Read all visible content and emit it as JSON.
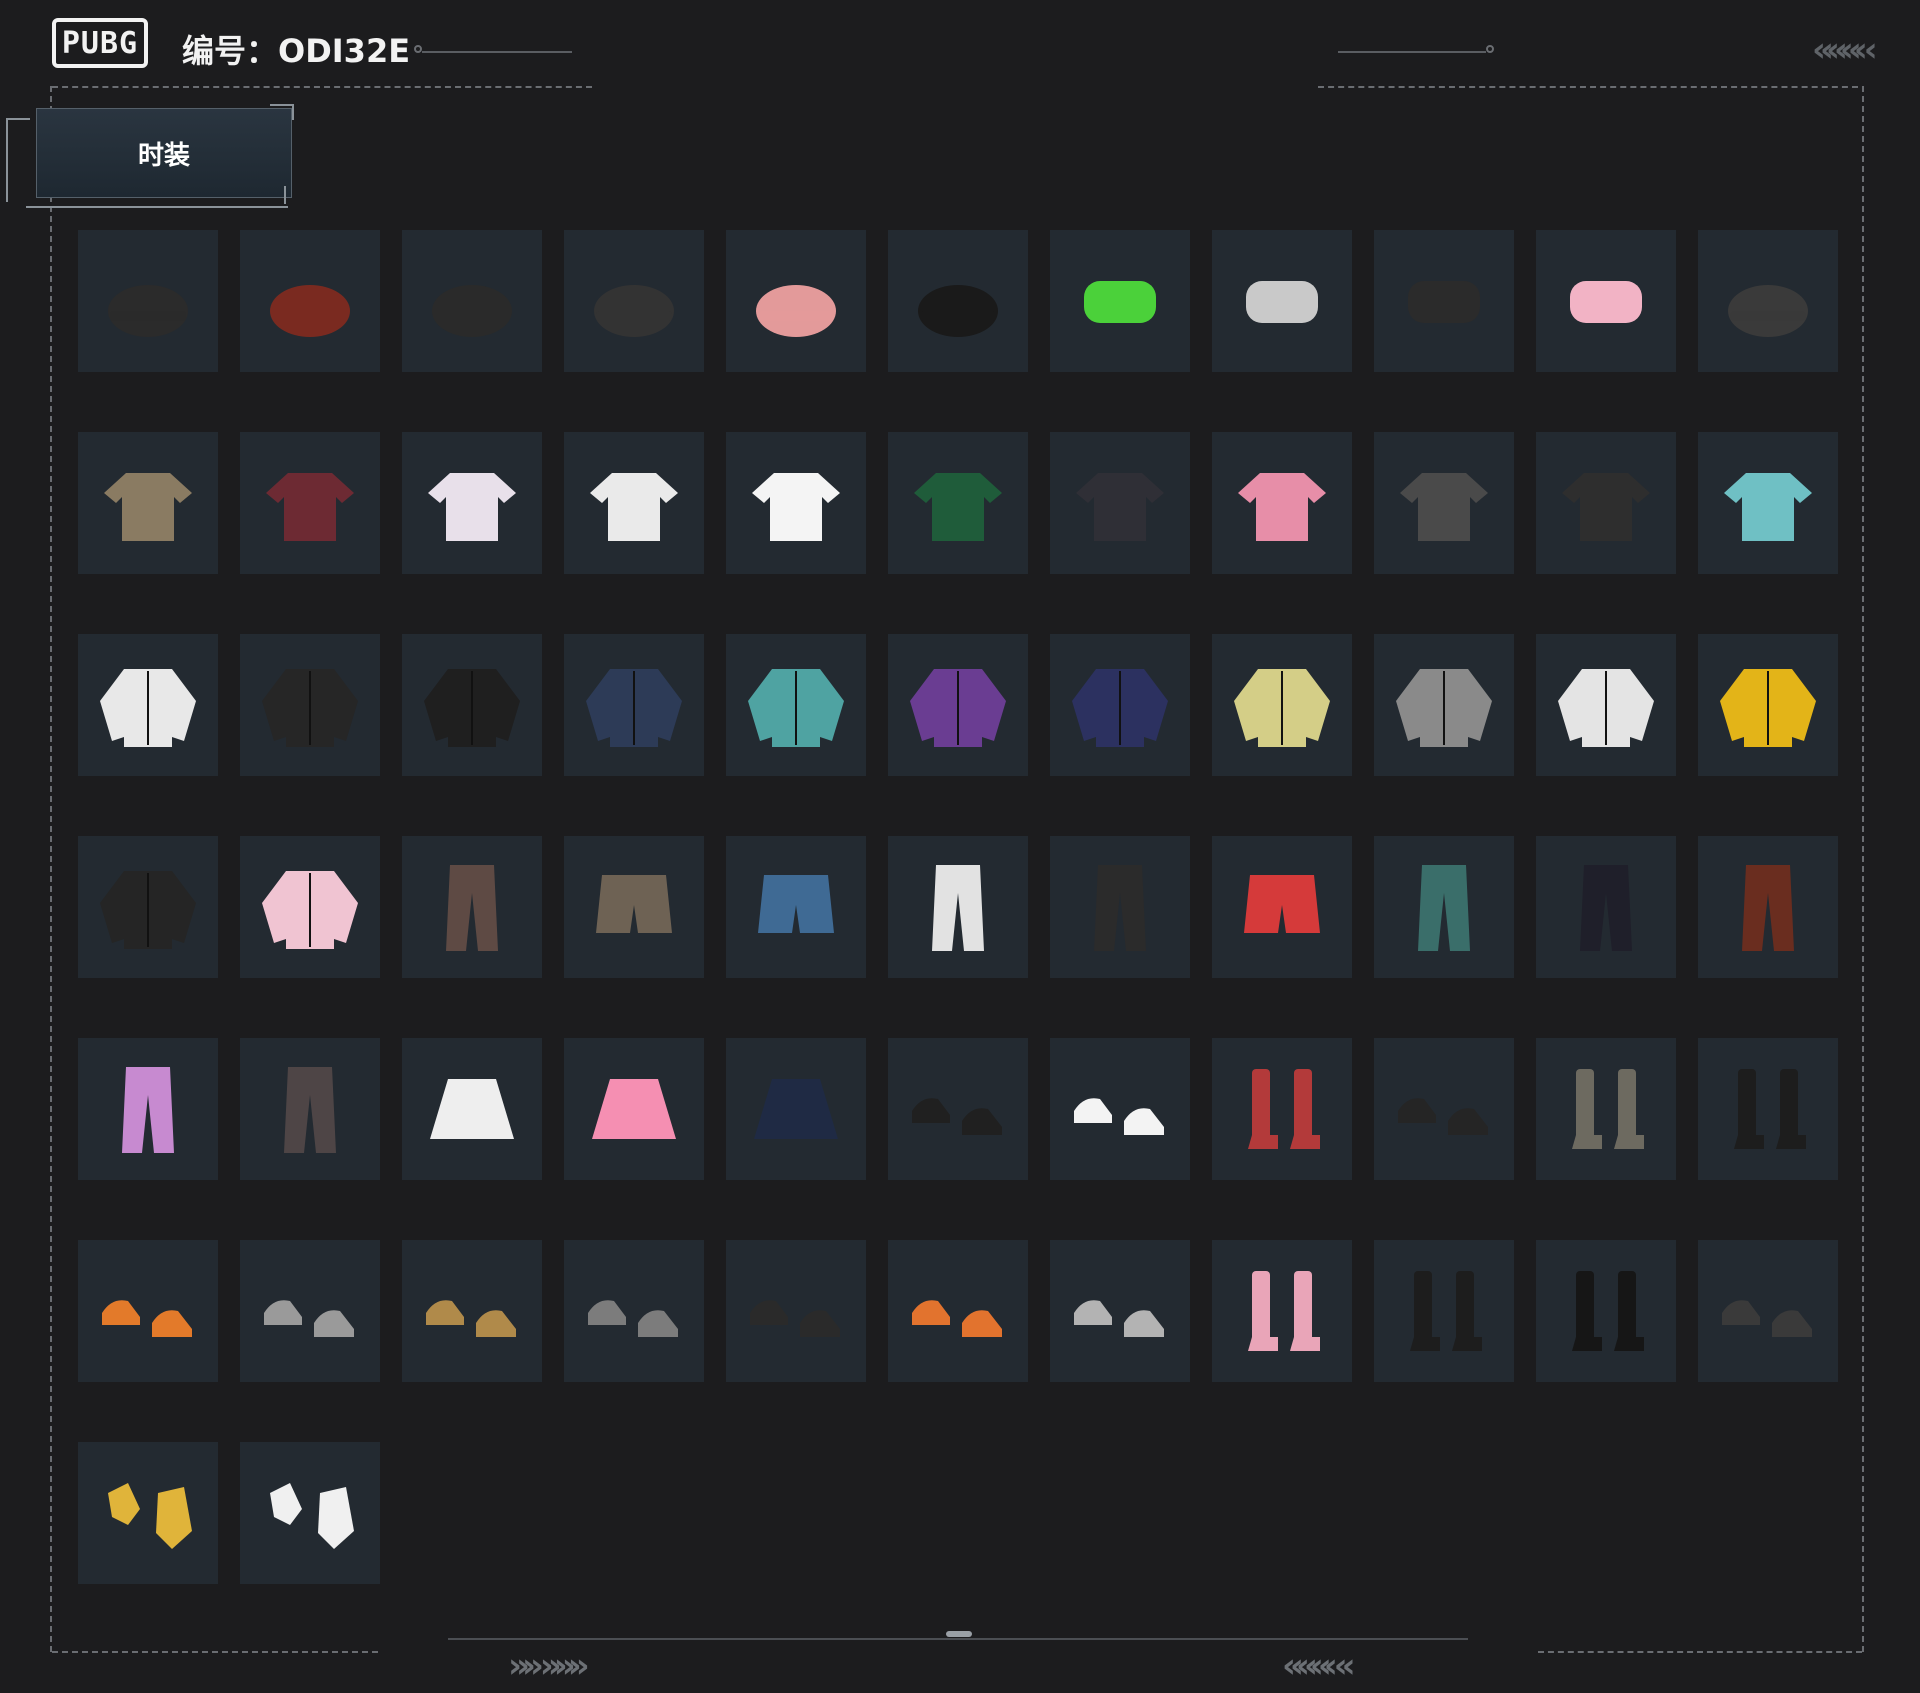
{
  "header": {
    "logo_text": "PUBG",
    "code_label": "编号：ODI32E",
    "chevrons_top_right": "«««‹ ‹",
    "chevrons_bottom_left": "»» »»»",
    "chevrons_bottom_right": "«««‹ «"
  },
  "tabs": [
    {
      "label": "时装",
      "active": true
    }
  ],
  "items": [
    {
      "icon": "baseball-cap-black",
      "color": "#2b2b2b"
    },
    {
      "icon": "roast-chicken-hat",
      "color": "#7a2a20"
    },
    {
      "icon": "cat-ears",
      "color": "#2a2a2a"
    },
    {
      "icon": "baseball-cap-camo",
      "color": "#333333"
    },
    {
      "icon": "ice-cream-cone-hat",
      "color": "#e39a9a"
    },
    {
      "icon": "panda-headband",
      "color": "#1a1a1a"
    },
    {
      "icon": "frog-mask",
      "color": "#4bd13a"
    },
    {
      "icon": "sunglasses",
      "color": "#c9c9c9"
    },
    {
      "icon": "red-bandana",
      "color": "#2b2b2b"
    },
    {
      "icon": "pink-face-mask",
      "color": "#f2b3c5"
    },
    {
      "icon": "black-scarf",
      "color": "#3a3a3a"
    },
    {
      "icon": "crop-top-tan",
      "color": "#8a7b62"
    },
    {
      "icon": "jersey-22",
      "color": "#6d2a33"
    },
    {
      "icon": "cat-tshirt",
      "color": "#e8e0ea"
    },
    {
      "icon": "star-sweatshirt",
      "color": "#eaeaea"
    },
    {
      "icon": "white-crop-tee",
      "color": "#f4f4f4"
    },
    {
      "icon": "green-dress",
      "color": "#1f5c3a"
    },
    {
      "icon": "school-blazer",
      "color": "#2f2f36"
    },
    {
      "icon": "pink-bodysuit",
      "color": "#e78ea8"
    },
    {
      "icon": "tattoo-sleeve-tank",
      "color": "#4a4a4a"
    },
    {
      "icon": "harness-top",
      "color": "#2e2e2e"
    },
    {
      "icon": "cyan-graphic-tee",
      "color": "#6fc0c4"
    },
    {
      "icon": "white-crop-jacket",
      "color": "#e8e8e8"
    },
    {
      "icon": "black-hoodie",
      "color": "#262626"
    },
    {
      "icon": "black-leather-jacket",
      "color": "#1f1f1f"
    },
    {
      "icon": "denim-bomber",
      "color": "#2d3b57"
    },
    {
      "icon": "teal-duck-hoodie",
      "color": "#4fa3a2"
    },
    {
      "icon": "purple-tracksuit-jacket",
      "color": "#6a3d92"
    },
    {
      "icon": "navy-sweater-sash",
      "color": "#2c3160"
    },
    {
      "icon": "chick-hoodie",
      "color": "#d4ce87"
    },
    {
      "icon": "orange-trim-jacket",
      "color": "#8a8a8a"
    },
    {
      "icon": "white-orange-jacket",
      "color": "#e4e4e4"
    },
    {
      "icon": "yellow-black-jacket",
      "color": "#e3b418"
    },
    {
      "icon": "black-suit-outfit",
      "color": "#252525"
    },
    {
      "icon": "pink-white-hoodie",
      "color": "#f0c4d2"
    },
    {
      "icon": "plaid-pants",
      "color": "#5e4a44"
    },
    {
      "icon": "khaki-shorts",
      "color": "#6e6254"
    },
    {
      "icon": "blue-jeans",
      "color": "#3f6a94"
    },
    {
      "icon": "white-belt-shorts",
      "color": "#e2e2e2"
    },
    {
      "icon": "black-cargo-pants",
      "color": "#2b2b2b"
    },
    {
      "icon": "patchwork-shorts",
      "color": "#d53a3a"
    },
    {
      "icon": "teal-shorts-leggings",
      "color": "#3a6e6a"
    },
    {
      "icon": "black-track-pants",
      "color": "#1f1f2a"
    },
    {
      "icon": "rust-pants",
      "color": "#6a2d1f"
    },
    {
      "icon": "pink-anime-pants",
      "color": "#c78ad0"
    },
    {
      "icon": "camo-pants",
      "color": "#4e4546"
    },
    {
      "icon": "white-pleated-skirt",
      "color": "#eeeeee"
    },
    {
      "icon": "pink-plaid-skirt",
      "color": "#f58fb2"
    },
    {
      "icon": "navy-skirt",
      "color": "#1f2a44"
    },
    {
      "icon": "black-pointed-shoes",
      "color": "#202020"
    },
    {
      "icon": "white-pink-boots",
      "color": "#f3f3f3"
    },
    {
      "icon": "red-high-tops",
      "color": "#b33a3a"
    },
    {
      "icon": "black-combat-boots",
      "color": "#252525"
    },
    {
      "icon": "gray-sneakers",
      "color": "#6d6a60"
    },
    {
      "icon": "black-red-boots",
      "color": "#1d1d1d"
    },
    {
      "icon": "orange-sneakers",
      "color": "#e37a2a"
    },
    {
      "icon": "gray-moon-boots",
      "color": "#9a9a9a"
    },
    {
      "icon": "tan-work-boots",
      "color": "#b08a4a"
    },
    {
      "icon": "gray-orange-sneakers",
      "color": "#7c7c7c"
    },
    {
      "icon": "black-hiking-shoes",
      "color": "#2a2a2a"
    },
    {
      "icon": "orange-high-tops",
      "color": "#e2732e"
    },
    {
      "icon": "gray-thigh-boots",
      "color": "#b3b3b3"
    },
    {
      "icon": "pink-fishnet-boots",
      "color": "#e9a5b8"
    },
    {
      "icon": "black-stockings",
      "color": "#1d1d1d"
    },
    {
      "icon": "black-gloves",
      "color": "#161616"
    },
    {
      "icon": "black-arm-wraps",
      "color": "#3a3a3a"
    },
    {
      "icon": "yellow-tactical-gloves",
      "color": "#e0b43a"
    },
    {
      "icon": "panda-gloves",
      "color": "#f0f0f0"
    }
  ]
}
